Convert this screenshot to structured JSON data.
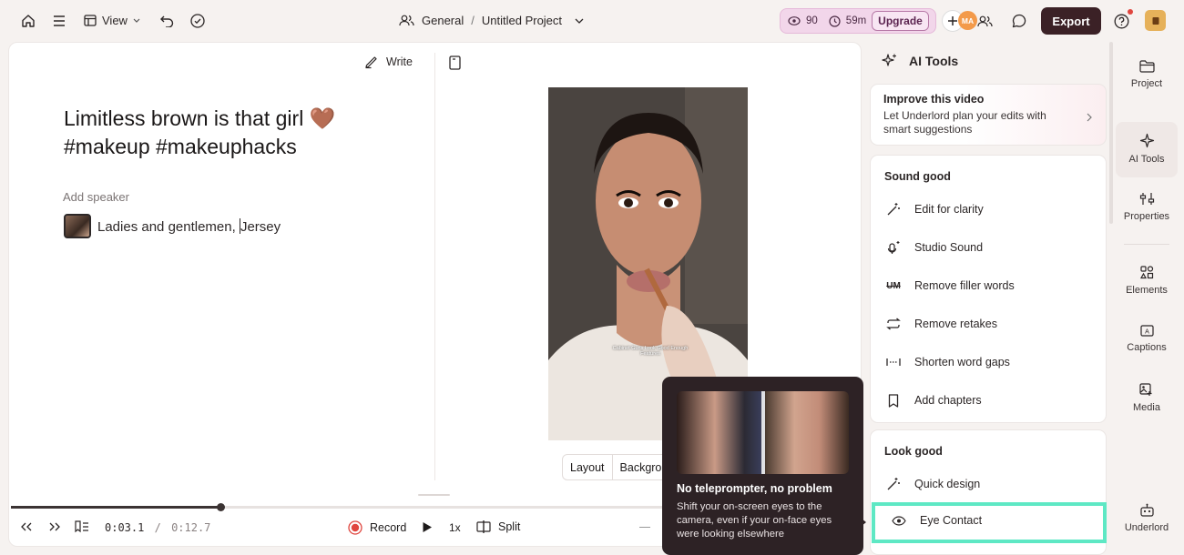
{
  "topbar": {
    "view_label": "View",
    "workspace": "General",
    "separator": "/",
    "project": "Untitled Project",
    "credits_value": "90",
    "minutes_value": "59m",
    "upgrade_label": "Upgrade",
    "avatar_initials": "MA",
    "export_label": "Export"
  },
  "editor": {
    "write_label": "Write",
    "script_title": "Limitless brown is that girl 🤎 #makeup #makeuphacks",
    "add_speaker": "Add speaker",
    "transcript_text_before_cursor": "Ladies and gentlemen, ",
    "transcript_text_after_cursor": "Jersey",
    "video_caption": "Cabinet Guns Look Good Enough Features",
    "layout_label": "Layout",
    "background_label": "Backgrou"
  },
  "playback": {
    "current_time": "0:03.1",
    "separator": "/",
    "total_time": "0:12.7",
    "record_label": "Record",
    "speed_label": "1x",
    "split_label": "Split",
    "progress_fraction": 0.32
  },
  "tooltip": {
    "title": "No teleprompter, no problem",
    "body": "Shift your on-screen eyes to the camera, even if your on-face eyes were looking elsewhere"
  },
  "ai_panel": {
    "title": "AI Tools",
    "improve_title": "Improve this video",
    "improve_body": "Let Underlord plan your edits with smart suggestions",
    "sound_title": "Sound good",
    "sound_items": [
      {
        "label": "Edit for clarity",
        "icon": "wand-icon"
      },
      {
        "label": "Studio Sound",
        "icon": "mic-sparkle-icon"
      },
      {
        "label": "Remove filler words",
        "icon": "strikethrough-um-icon"
      },
      {
        "label": "Remove retakes",
        "icon": "repeat-icon"
      },
      {
        "label": "Shorten word gaps",
        "icon": "gap-icon"
      },
      {
        "label": "Add chapters",
        "icon": "bookmark-icon"
      }
    ],
    "look_title": "Look good",
    "look_items": [
      {
        "label": "Quick design",
        "icon": "wand-icon"
      },
      {
        "label": "Eye Contact",
        "icon": "eye-icon"
      }
    ]
  },
  "rail": {
    "items": [
      {
        "label": "Project",
        "icon": "folder-icon"
      },
      {
        "label": "AI Tools",
        "icon": "sparkle-icon"
      },
      {
        "label": "Properties",
        "icon": "sliders-icon"
      },
      {
        "label": "Elements",
        "icon": "shapes-icon"
      },
      {
        "label": "Captions",
        "icon": "captions-icon"
      },
      {
        "label": "Media",
        "icon": "media-icon"
      },
      {
        "label": "Underlord",
        "icon": "robot-icon"
      }
    ]
  },
  "colors": {
    "accent_export": "#3b2126",
    "upgrade_bg": "#f2d6ea",
    "highlight": "#5ee8c4",
    "record_red": "#e0463f",
    "tooltip_bg": "#2d2225"
  }
}
